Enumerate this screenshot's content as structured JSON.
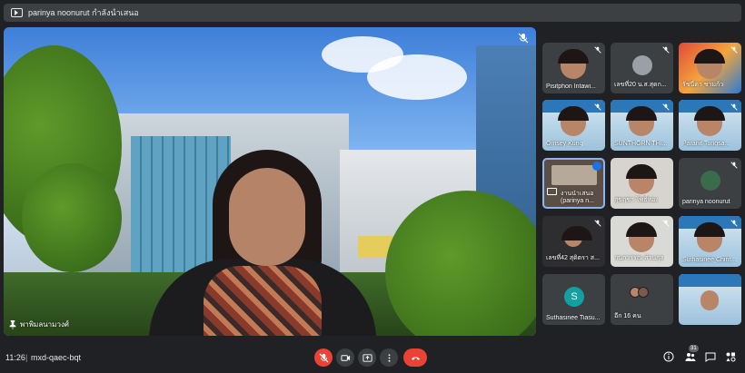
{
  "presenting_bar": {
    "title": "parinya noonurut กำลังนำเสนอ"
  },
  "stage": {
    "pinned_name": "พาพิมลนามวงศ์"
  },
  "tiles": [
    {
      "name": "Pisitphon Intawi...",
      "kind": "camera"
    },
    {
      "name": "เลขที่20 น.ส.สุดก...",
      "kind": "camera"
    },
    {
      "name": "รัชนี่ตา ชามก้ว",
      "kind": "camera"
    },
    {
      "name": "Omsey Kung",
      "kind": "slide"
    },
    {
      "name": "SUNTHORN THI...",
      "kind": "slide"
    },
    {
      "name": "Paranit Tongsa...",
      "kind": "slide"
    },
    {
      "name": "งานนำเสนอ (parinya n...",
      "kind": "presentation"
    },
    {
      "name": "สุขฤชา โพธิ์ทอง",
      "kind": "camera"
    },
    {
      "name": "parinya noonurut",
      "kind": "avatar"
    },
    {
      "name": "เลขที่42 สุดิตรา ส...",
      "kind": "camera"
    },
    {
      "name": "กนกวรรณ ส่วนกุล",
      "kind": "camera"
    },
    {
      "name": "Suthasinee Chint...",
      "kind": "slide"
    },
    {
      "name": "Suthasinee Tiasu...",
      "kind": "letter",
      "letter": "S"
    },
    {
      "name": "อีก 16 คน",
      "kind": "others"
    },
    {
      "name": "",
      "kind": "slide"
    }
  ],
  "bottombar": {
    "time": "11:26",
    "separator": "|",
    "meeting_code": "mxd-qaec-bqt",
    "participants_count": "31"
  },
  "colors": {
    "accent": "#8ab4f8",
    "danger": "#ea4335",
    "bar": "#3c4043",
    "bg": "#202124"
  }
}
